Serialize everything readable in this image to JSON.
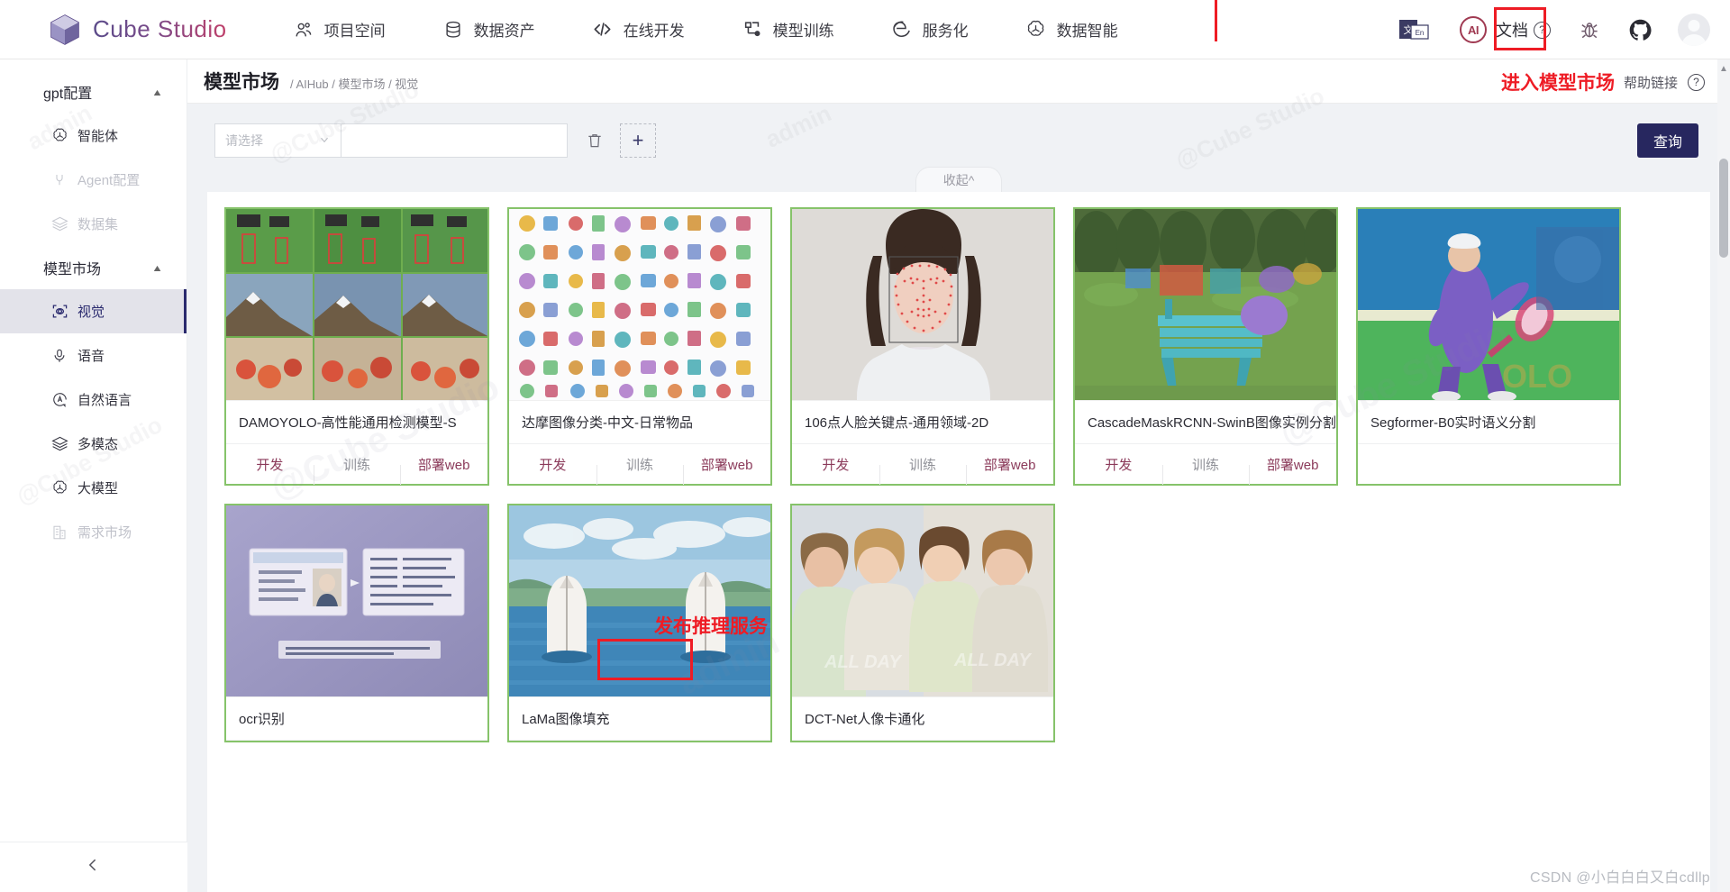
{
  "topnav": {
    "brand": "Cube Studio",
    "items": [
      {
        "label": "项目空间",
        "icon": "users-icon"
      },
      {
        "label": "数据资产",
        "icon": "database-icon"
      },
      {
        "label": "在线开发",
        "icon": "code-icon"
      },
      {
        "label": "模型训练",
        "icon": "workflow-icon"
      },
      {
        "label": "服务化",
        "icon": "explorer-icon"
      },
      {
        "label": "数据智能",
        "icon": "openai-icon"
      }
    ],
    "right": {
      "translate_label": "文",
      "translate_sub": "En",
      "ai_badge": "AI",
      "doc_label": "文档",
      "help_mark": "?",
      "bug_icon": "bug-icon",
      "github_icon": "github-icon",
      "avatar": "user-avatar"
    }
  },
  "sidebar": {
    "groups": [
      {
        "label": "gpt配置",
        "expanded": true,
        "items": [
          {
            "label": "智能体",
            "icon": "openai-icon",
            "state": "normal"
          },
          {
            "label": "Agent配置",
            "icon": "plug-icon",
            "state": "disabled"
          },
          {
            "label": "数据集",
            "icon": "layers-icon",
            "state": "disabled"
          }
        ]
      },
      {
        "label": "模型市场",
        "expanded": true,
        "items": [
          {
            "label": "视觉",
            "icon": "scan-eye-icon",
            "state": "active"
          },
          {
            "label": "语音",
            "icon": "mic-icon",
            "state": "normal"
          },
          {
            "label": "自然语言",
            "icon": "letter-a-circle-icon",
            "state": "normal"
          },
          {
            "label": "多模态",
            "icon": "layers-icon",
            "state": "normal"
          },
          {
            "label": "大模型",
            "icon": "openai-icon",
            "state": "normal"
          },
          {
            "label": "需求市场",
            "icon": "building-icon",
            "state": "disabled"
          }
        ]
      }
    ],
    "collapse_icon": "chevron-left-icon"
  },
  "page": {
    "title": "模型市场",
    "breadcrumb": "/ AIHub / 模型市场 / 视觉",
    "enter_market": "进入模型市场",
    "help_link": "帮助链接",
    "help_mark": "?"
  },
  "filter": {
    "select_placeholder": "请选择",
    "select_value": "",
    "input_value": "",
    "input_placeholder": "",
    "delete_icon": "trash-icon",
    "add_icon": "plus-icon",
    "query_label": "查询",
    "collapse_label": "收起^"
  },
  "annotations": {
    "deploy_note": "发布推理服务"
  },
  "card_actions": {
    "dev": "开发",
    "train": "训练",
    "deploy": "部署web"
  },
  "cards": [
    {
      "title": "DAMOYOLO-高性能通用检测模型-S",
      "thumb": "object-detection-grid",
      "highlight_deploy": true
    },
    {
      "title": "达摩图像分类-中文-日常物品",
      "thumb": "icon-collage"
    },
    {
      "title": "106点人脸关键点-通用领域-2D",
      "thumb": "face-landmarks"
    },
    {
      "title": "CascadeMaskRCNN-SwinB图像实例分割",
      "thumb": "park-bench-segmentation"
    },
    {
      "title": "Segformer-B0实时语义分割",
      "thumb": "tennis-player"
    },
    {
      "title": "ocr识别",
      "thumb": "id-card-ocr"
    },
    {
      "title": "LaMa图像填充",
      "thumb": "boat-sea"
    },
    {
      "title": "DCT-Net人像卡通化",
      "thumb": "portrait-cartoon"
    }
  ],
  "watermarks": {
    "admin": "admin",
    "cube": "@Cube Studio",
    "csdn": "CSDN @小白白白又白cdllp"
  }
}
